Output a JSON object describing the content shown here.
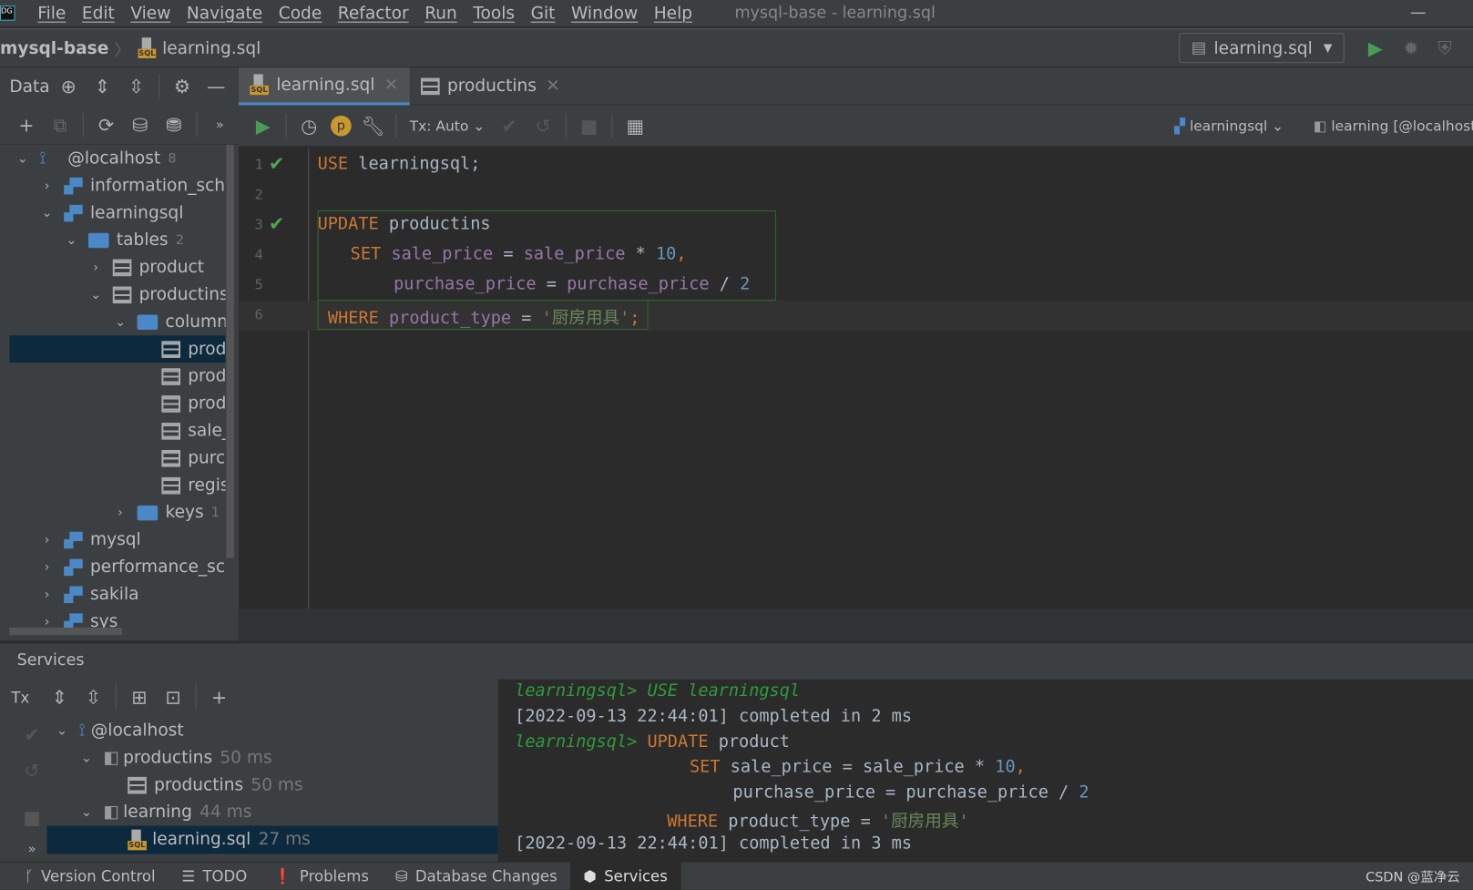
{
  "menu": {
    "items": [
      "File",
      "Edit",
      "View",
      "Navigate",
      "Code",
      "Refactor",
      "Run",
      "Tools",
      "Git",
      "Window",
      "Help"
    ],
    "window_title": "mysql-base - learning.sql",
    "minimize": "—"
  },
  "nav": {
    "project": "mysql-base",
    "file": "learning.sql",
    "run_config": "learning.sql"
  },
  "db_panel": {
    "title": "Data",
    "tree": [
      {
        "label": "@localhost",
        "count": "8"
      },
      {
        "label": "information_schen"
      },
      {
        "label": "learningsql"
      },
      {
        "label": "tables",
        "count": "2"
      },
      {
        "label": "product"
      },
      {
        "label": "productins"
      },
      {
        "label": "columns"
      },
      {
        "label": "produ"
      },
      {
        "label": "produ"
      },
      {
        "label": "produ"
      },
      {
        "label": "sale_p"
      },
      {
        "label": "purch"
      },
      {
        "label": "regist"
      },
      {
        "label": "keys",
        "count": "1"
      },
      {
        "label": "mysql"
      },
      {
        "label": "performance_sche"
      },
      {
        "label": "sakila"
      },
      {
        "label": "sys"
      }
    ]
  },
  "editor": {
    "tabs": [
      {
        "label": "learning.sql",
        "active": true
      },
      {
        "label": "productins",
        "active": false
      }
    ],
    "tx": "Tx: Auto",
    "schema": "learningsql",
    "session": "learning [@localhost]",
    "line_numbers": [
      "1",
      "2",
      "3",
      "4",
      "5",
      "6"
    ],
    "lines": {
      "l1": {
        "kw": "USE",
        "rest": " learningsql;"
      },
      "l3": {
        "kw": "UPDATE",
        "rest": " productins"
      },
      "l4": {
        "kw": "SET",
        "a": "sale_price",
        "eq": " = ",
        "b": "sale_price",
        "op": " * ",
        "n": "10",
        "end": ","
      },
      "l5": {
        "a": "purchase_price",
        "eq": " = ",
        "b": "purchase_price",
        "op": " / ",
        "n": "2"
      },
      "l6": {
        "kw": "WHERE",
        "a": "product_type",
        "eq": " = ",
        "s": "'厨房用具'",
        "end": ";"
      }
    }
  },
  "services": {
    "title": "Services",
    "tx": "Tx",
    "tree": [
      {
        "label": "@localhost"
      },
      {
        "label": "productins",
        "time": "50 ms"
      },
      {
        "label": "productins",
        "time": "50 ms"
      },
      {
        "label": "learning",
        "time": "44 ms"
      },
      {
        "label": "learning.sql",
        "time": "27 ms"
      }
    ]
  },
  "console": {
    "top_partial": "learningsql> USE learningsql",
    "done1": "[2022-09-13 22:44:01] completed in 2 ms",
    "prompt": "learningsql>",
    "upd": "UPDATE",
    "upd_rest": " product",
    "set": "SET",
    "set_rest": " sale_price = sale_price * ",
    "n10": "10",
    "comma": ",",
    "pp": "purchase_price = purchase_price / ",
    "n2": "2",
    "where": "WHERE",
    "where_rest": " product_type = ",
    "str": "'厨房用具'",
    "done2": "[2022-09-13 22:44:01] completed in 3 ms"
  },
  "statusbar": {
    "items": [
      "Version Control",
      "TODO",
      "Problems",
      "Database Changes",
      "Services"
    ],
    "watermark": "CSDN @蓝净云"
  }
}
